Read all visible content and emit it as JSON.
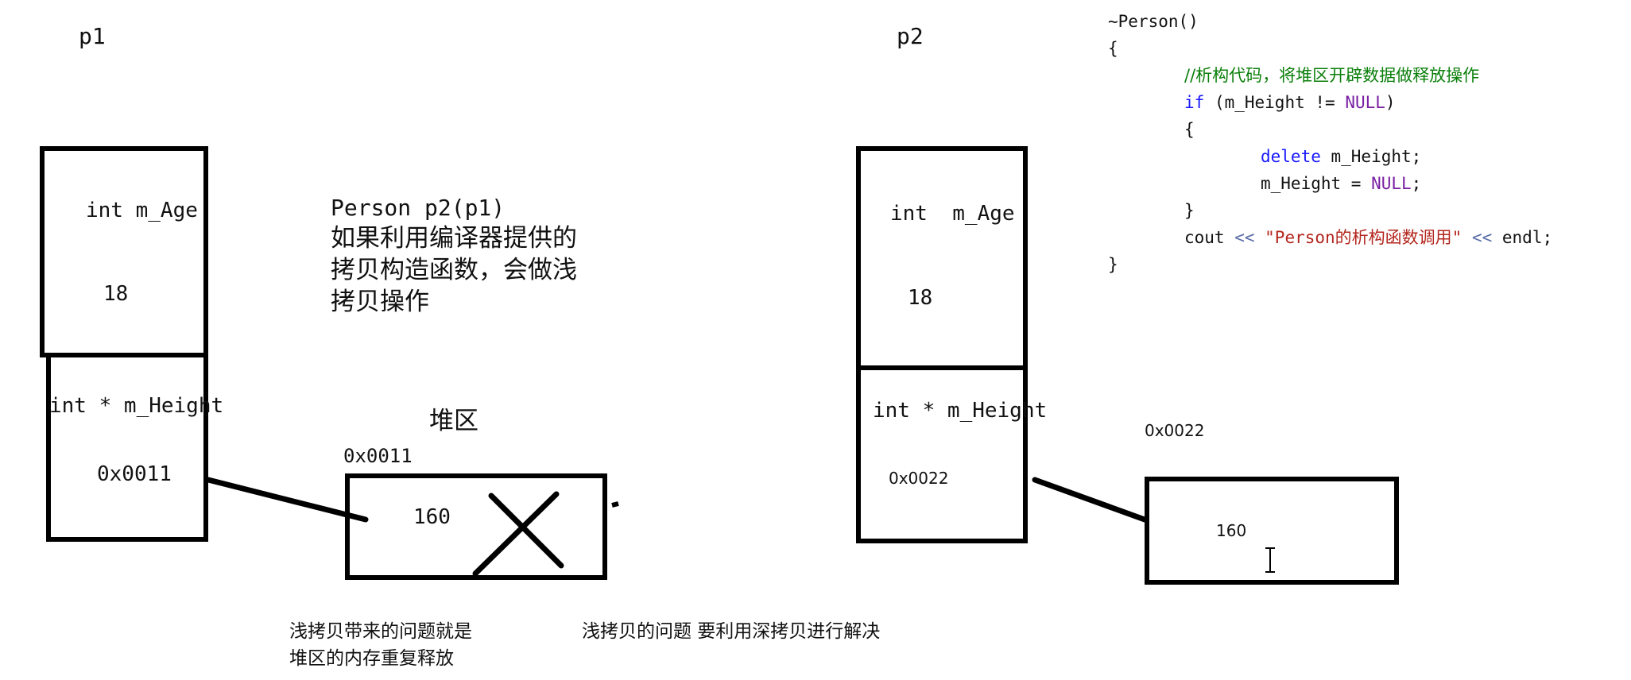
{
  "p1": {
    "label": "p1",
    "field_age": "int m_Age",
    "age_value": "18",
    "field_height": "int * m_Height",
    "height_value": "0x0011"
  },
  "p2": {
    "label": "p2",
    "field_age": "int  m_Age",
    "age_value": "18",
    "field_height": "int * m_Height",
    "height_value": "0x0022"
  },
  "copy_note": {
    "line1": "Person p2(p1)",
    "line2": "如果利用编译器提供的",
    "line3": "拷贝构造函数，会做浅",
    "line4": "拷贝操作"
  },
  "heap": {
    "title": "堆区",
    "address1": "0x0011",
    "value1": "160",
    "address2": "0x0022",
    "value2": "160"
  },
  "notes": {
    "problem_line1": "浅拷贝带来的问题就是",
    "problem_line2": "堆区的内存重复释放",
    "solution": "浅拷贝的问题 要利用深拷贝进行解决"
  },
  "code": {
    "l1": "~Person()",
    "l2": "{",
    "l3": "//析构代码，将堆区开辟数据做释放操作",
    "l4_kw": "if",
    "l4_a": " (m_Height != ",
    "l4_null": "NULL",
    "l4_b": ")",
    "l5": "{",
    "l6_kw": "delete",
    "l6_b": " m_Height;",
    "l7_a": "m_Height = ",
    "l7_null": "NULL",
    "l7_b": ";",
    "l8": "}",
    "l9_a": "cout ",
    "l9_op1": "<<",
    "l9_str": " \"Person的析构函数调用\" ",
    "l9_op2": "<<",
    "l9_b": " endl;",
    "l10": "}"
  },
  "colors": {
    "keyword": "#1a1aff",
    "comment": "#0a7f0a",
    "null": "#7a1fa2",
    "string": "#b3261e",
    "stroke": "#000000"
  }
}
